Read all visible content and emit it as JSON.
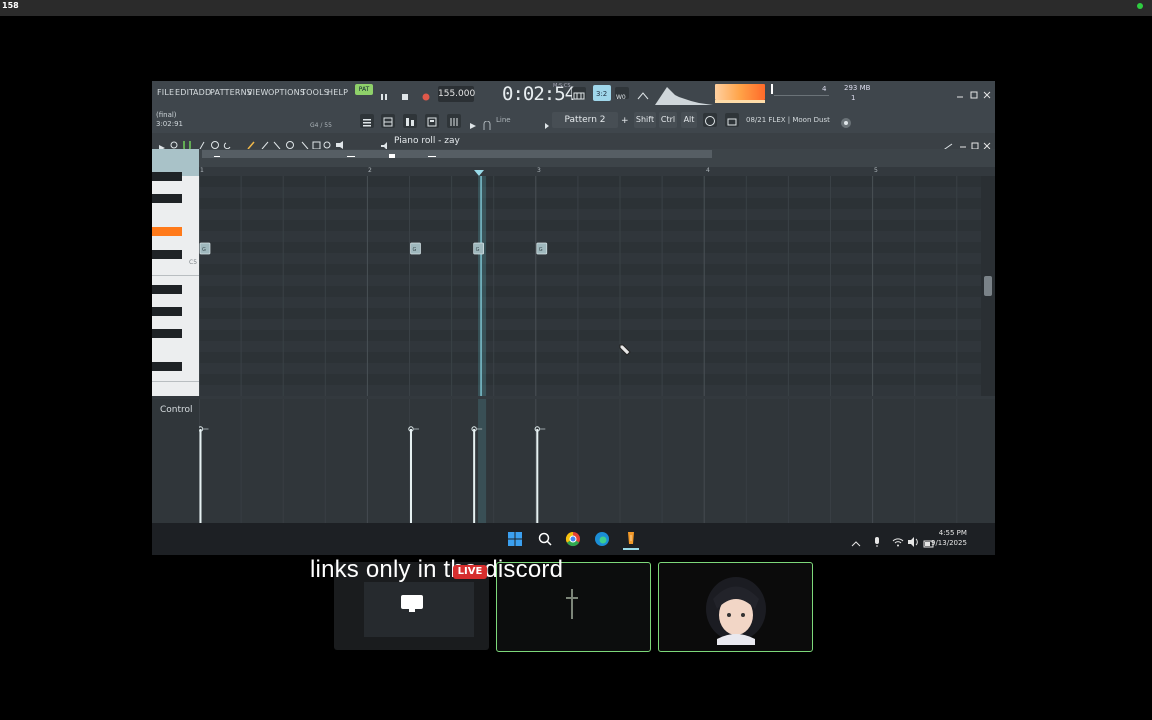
{
  "topbar": {
    "fps": "158"
  },
  "fl": {
    "menus": [
      "FILE",
      "EDIT",
      "ADD",
      "PATTERNS",
      "VIEW",
      "OPTIONS",
      "TOOLS",
      "HELP"
    ],
    "pat_label": "PAT",
    "tempo": "155.000",
    "time": "0:02:54",
    "time_unit": "M:S:CS",
    "cpu": "4",
    "memory": "293 MB",
    "voices": "1",
    "hint_line1": "(final)",
    "hint_line2": "3:02:91",
    "key_label": "G4 / 55",
    "snap": "Line",
    "pattern": "Pattern 2",
    "shift": "Shift",
    "ctrl": "Ctrl",
    "alt": "Alt",
    "plugin_info": "08/21 FLEX | Moon Dust"
  },
  "piano_roll": {
    "title": "Piano roll - zay",
    "bar_numbers": [
      "1",
      "2",
      "3",
      "4",
      "5"
    ],
    "key_label": "C5",
    "note_label": "G",
    "notes_beats": [
      0,
      5,
      6.5,
      8
    ],
    "control_label": "Control"
  },
  "taskbar": {
    "time": "4:55 PM",
    "date": "9/13/2025"
  },
  "overlay": {
    "caption": "links only in the discord",
    "live": "LIVE"
  },
  "colors": {
    "accent_green": "#7dd87a",
    "note_orange": "#ff7a1a",
    "live_red": "#d62e2e"
  }
}
